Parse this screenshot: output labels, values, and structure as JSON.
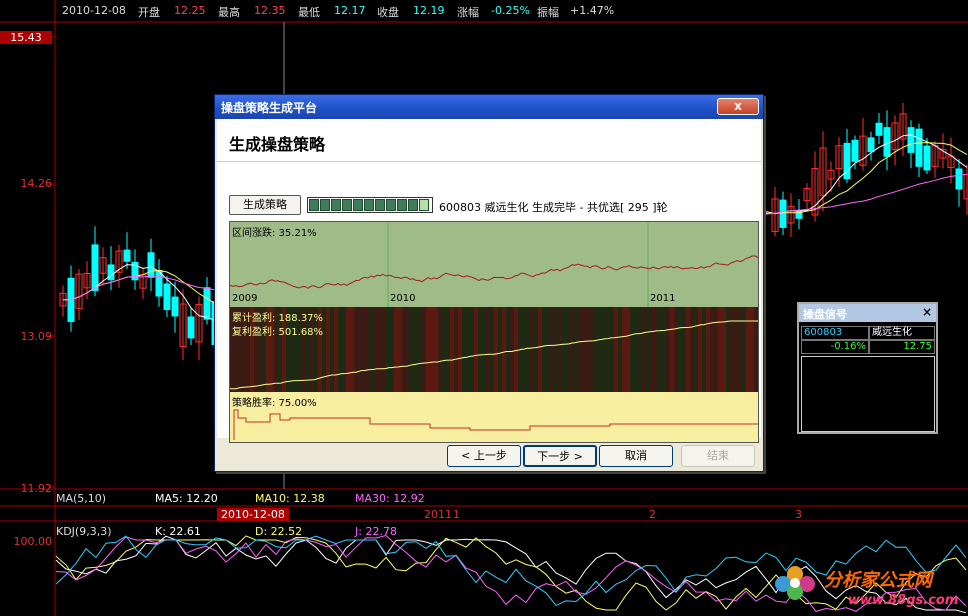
{
  "topbar": {
    "date": "2010-12-08",
    "open_label": "开盘",
    "open_value": "12.25",
    "high_label": "最高",
    "high_value": "12.35",
    "low_label": "最低",
    "low_value": "12.17",
    "close_label": "收盘",
    "close_value": "12.19",
    "change_label": "涨幅",
    "change_value": "-0.25%",
    "amplitude_label": "振幅",
    "amplitude_value": "+1.47%"
  },
  "price_axis": {
    "labels": [
      "15.43",
      "14.26",
      "13.09",
      "11.92"
    ],
    "kdj_top": "100.00"
  },
  "ma_bar": {
    "title": "MA(5,10)",
    "ma5": "MA5: 12.20",
    "ma10": "MA10: 12.38",
    "ma30": "MA30: 12.92"
  },
  "date_strip": {
    "current": "2010-12-08",
    "markers": [
      "2011",
      "1",
      "2",
      "3"
    ]
  },
  "kdj_bar": {
    "title": "KDJ(9,3,3)",
    "k": "K: 22.61",
    "d": "D: 22.52",
    "j": "J: 22.78"
  },
  "dialog": {
    "title": "操盘策略生成平台",
    "close_label": "x",
    "heading": "生成操盘策略",
    "gen_button": "生成策略",
    "progress_blocks_dark": 10,
    "status_text": "600803 威远生化  生成完毕 - 共优选[ 295 ]轮",
    "panel1_label": "区间涨跌: 35.21%",
    "panel1_years": [
      "2009",
      "2010",
      "2011"
    ],
    "panel2_label1": "累计盈利: 188.37%",
    "panel2_label2": "复利盈利: 501.68%",
    "panel3_label": "策略胜率: 75.00%",
    "buttons": {
      "prev": "< 上一步",
      "next": "下一步 >",
      "cancel": "取消",
      "finish": "结束"
    }
  },
  "signal": {
    "title": "操盘信号",
    "close_label": "×",
    "code": "600803",
    "name": "威远生化",
    "change": "-0.16%",
    "price": "12.75"
  },
  "watermark": {
    "site_name": "分析家公式网",
    "url": "www.88gs.com"
  },
  "colors": {
    "up": "#ff3030",
    "down": "#00ffff",
    "axis": "#aa0000",
    "ma5": "#ffffff",
    "ma10": "#ffff66",
    "ma30": "#ff66ff"
  }
}
